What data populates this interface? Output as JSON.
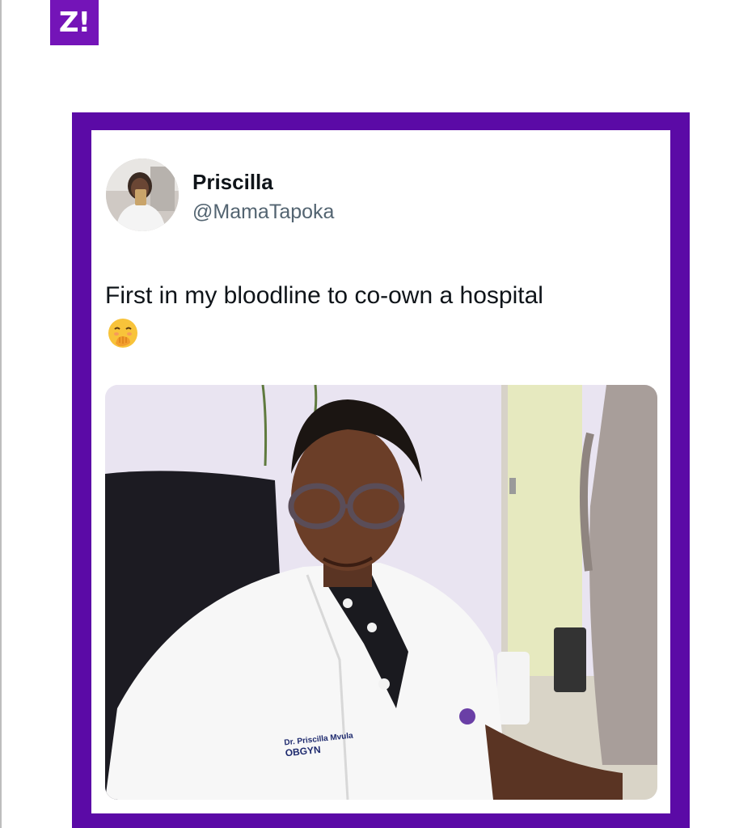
{
  "brand": {
    "logo_text": "Z!",
    "accent_color": "#5b0aa6",
    "logo_color": "#7414b8"
  },
  "tweet": {
    "display_name": "Priscilla",
    "handle": "@MamaTapoka",
    "text": "First in my bloodline to co-own a hospital",
    "emoji": "face-with-hand-over-mouth",
    "photo": {
      "coat_name": "Dr. Priscilla Mvula",
      "coat_title": "OBGYN"
    }
  }
}
